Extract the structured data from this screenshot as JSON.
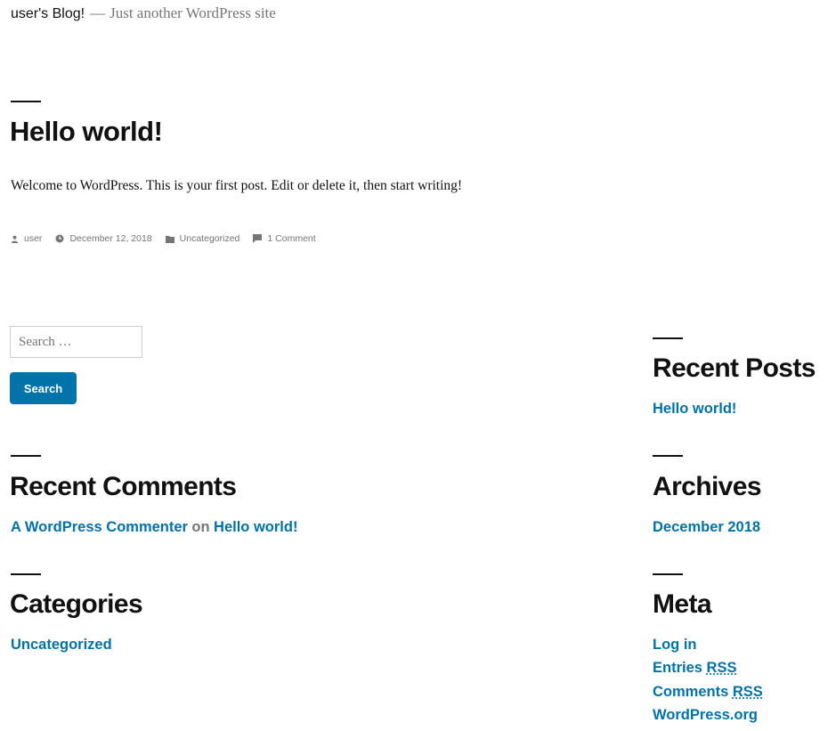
{
  "site": {
    "title": "user's Blog!",
    "separator": "—",
    "description": "Just another WordPress site"
  },
  "post": {
    "title": "Hello world!",
    "content": "Welcome to WordPress. This is your first post. Edit or delete it, then start writing!",
    "meta": {
      "author": "user",
      "date": "December 12, 2018",
      "category": "Uncategorized",
      "comments": "1 Comment"
    }
  },
  "search": {
    "placeholder": "Search …",
    "button_label": "Search"
  },
  "widgets": {
    "recent_posts": {
      "title": "Recent Posts",
      "items": [
        "Hello world!"
      ]
    },
    "recent_comments": {
      "title": "Recent Comments",
      "author": "A WordPress Commenter",
      "connector": "on",
      "post": "Hello world!"
    },
    "archives": {
      "title": "Archives",
      "items": [
        "December 2018"
      ]
    },
    "categories": {
      "title": "Categories",
      "items": [
        "Uncategorized"
      ]
    },
    "meta": {
      "title": "Meta",
      "log_in": "Log in",
      "entries_label": "Entries",
      "comments_label": "Comments",
      "rss": "RSS",
      "wordpress_org": "WordPress.org"
    }
  },
  "colors": {
    "accent": "#0073aa",
    "text": "#111111",
    "muted": "#767676"
  },
  "icons": {
    "author": "person-icon",
    "date": "clock-icon",
    "category": "folder-icon",
    "comments": "comment-bubble-icon"
  }
}
